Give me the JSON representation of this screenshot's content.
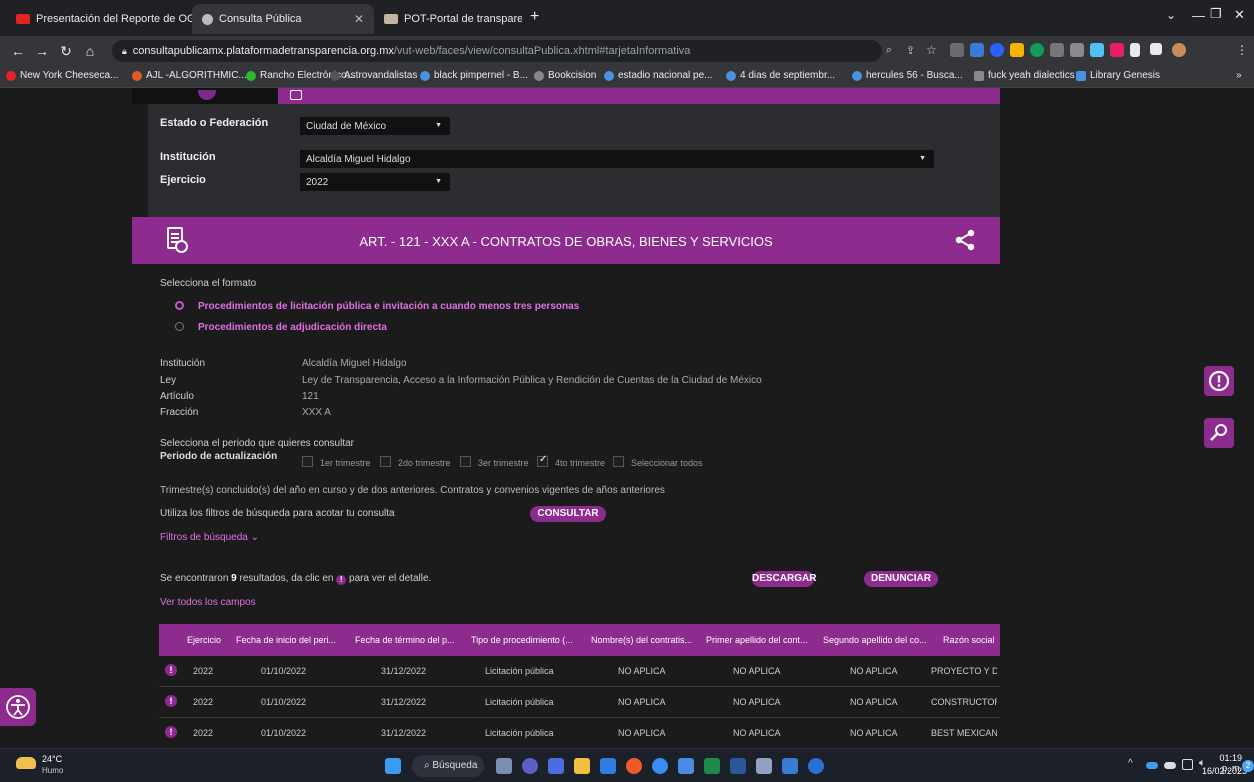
{
  "browser": {
    "tabs": [
      {
        "title": "Presentación del Reporte de OGI",
        "favicon_color": "#e02424",
        "active": false
      },
      {
        "title": "Consulta Pública",
        "favicon_color": "#bbbbbb",
        "active": true
      },
      {
        "title": "POT-Portal de transparencia",
        "favicon_color": "#c4b5a0",
        "active": false
      }
    ],
    "new_tab_symbol": "+",
    "url_domain": "consultapublicamx.plataformadetransparencia.org.mx",
    "url_path": "/vut-web/faces/view/consultaPublica.xhtml#tarjetaInformativa",
    "bookmarks": [
      {
        "label": "New York Cheeseca...",
        "color": "#e02424"
      },
      {
        "label": "AJL -ALGORITHMIC...",
        "color": "#e05a24"
      },
      {
        "label": "Rancho Electrónico...",
        "color": "#2eb82e"
      },
      {
        "label": "Astrovandalistas",
        "color": "#555555"
      },
      {
        "label": "black pimpernel - B...",
        "color": "#4a90e2"
      },
      {
        "label": "Bookcision",
        "color": "#888888"
      },
      {
        "label": "estadio nacional pe...",
        "color": "#4a90e2"
      },
      {
        "label": "4 dias de septiembr...",
        "color": "#4a90e2"
      },
      {
        "label": "hercules 56 - Busca...",
        "color": "#4a90e2"
      },
      {
        "label": "fuck yeah dialectics",
        "color": "#888888"
      },
      {
        "label": "Library Genesis",
        "color": "#4a90e2"
      }
    ],
    "bookmarks_more": "»"
  },
  "filters": {
    "estado_label": "Estado o Federación",
    "estado_value": "Ciudad de México",
    "institucion_label": "Institución",
    "institucion_value": "Alcaldía Miguel Hidalgo",
    "ejercicio_label": "Ejercicio",
    "ejercicio_value": "2022"
  },
  "article": {
    "title": "ART. - 121 - XXX A - CONTRATOS DE OBRAS, BIENES Y SERVICIOS"
  },
  "format": {
    "prompt": "Selecciona el formato",
    "options": [
      {
        "label": "Procedimientos de licitación pública e invitación a cuando menos tres personas",
        "selected": true
      },
      {
        "label": "Procedimientos de adjudicación directa",
        "selected": false
      }
    ]
  },
  "info": {
    "institucion_label": "Institución",
    "institucion_value": "Alcaldía Miguel Hidalgo",
    "ley_label": "Ley",
    "ley_value": "Ley de Transparencia, Acceso a la Información Pública y Rendición de Cuentas de la Ciudad de México",
    "articulo_label": "Artículo",
    "articulo_value": "121",
    "fraccion_label": "Fracción",
    "fraccion_value": "XXX A"
  },
  "period": {
    "prompt": "Selecciona el periodo que quieres consultar",
    "label": "Periodo de actualización",
    "options": [
      {
        "label": "1er trimestre",
        "checked": false
      },
      {
        "label": "2do trimestre",
        "checked": false
      },
      {
        "label": "3er trimestre",
        "checked": false
      },
      {
        "label": "4to trimestre",
        "checked": true
      },
      {
        "label": "Seleccionar todos",
        "checked": false
      }
    ],
    "note": "Trimestre(s) concluido(s) del año en curso y de dos anteriores. Contratos y convenios vigentes de años anteriores"
  },
  "search": {
    "hint": "Utiliza los filtros de búsqueda para acotar tu consulta",
    "consult_button": "CONSULTAR",
    "filters_toggle": "Filtros de búsqueda ⌄"
  },
  "results": {
    "prefix": "Se encontraron",
    "count": "9",
    "suffix_1": "resultados, da clic en",
    "suffix_2": "para ver el detalle.",
    "download_button": "DESCARGAR",
    "report_button": "DENUNCIAR",
    "all_fields_link": "Ver todos los campos"
  },
  "table": {
    "headers": [
      "Ejercicio",
      "Fecha de inicio del peri...",
      "Fecha de término del p...",
      "Tipo de procedimiento (...",
      "Nombre(s) del contratis...",
      "Primer apellido del cont...",
      "Segundo apellido del co...",
      "Razón social"
    ],
    "rows": [
      [
        "2022",
        "01/10/2022",
        "31/12/2022",
        "Licitación pública",
        "NO APLICA",
        "NO APLICA",
        "NO APLICA",
        "PROYECTO Y DE"
      ],
      [
        "2022",
        "01/10/2022",
        "31/12/2022",
        "Licitación pública",
        "NO APLICA",
        "NO APLICA",
        "NO APLICA",
        "CONSTRUCTORA"
      ],
      [
        "2022",
        "01/10/2022",
        "31/12/2022",
        "Licitación pública",
        "NO APLICA",
        "NO APLICA",
        "NO APLICA",
        "BEST MEXICAN"
      ]
    ]
  },
  "taskbar": {
    "temperature": "24°C",
    "weather": "Humo",
    "search_label": "Búsqueda",
    "time": "01:19 p. m.",
    "date": "16/02/2023",
    "notification_count": "2"
  }
}
